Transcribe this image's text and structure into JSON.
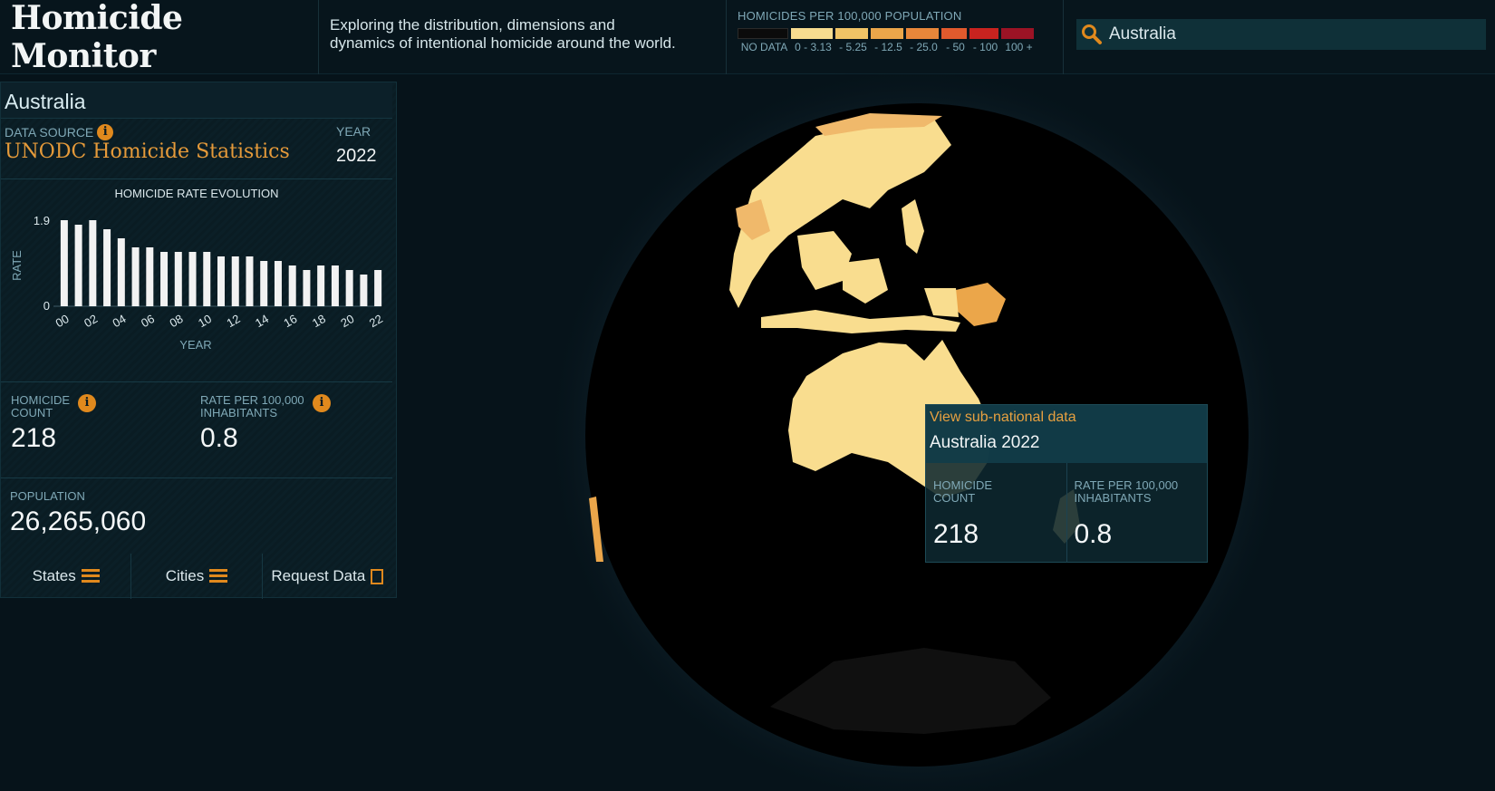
{
  "header": {
    "title": "Homicide Monitor",
    "tagline_line1": "Exploring the distribution, dimensions and",
    "tagline_line2": "dynamics of intentional homicide around the world.",
    "legend_title": "HOMICIDES PER 100,000 POPULATION",
    "legend": [
      {
        "label": "NO DATA",
        "color": "#0b0b0b"
      },
      {
        "label": "0 - 3.13",
        "color": "#f7dc8f"
      },
      {
        "label": "- 5.25",
        "color": "#f0c466"
      },
      {
        "label": "- 12.5",
        "color": "#eba64a"
      },
      {
        "label": "- 25.0",
        "color": "#e8873a"
      },
      {
        "label": "- 50",
        "color": "#e15a2d"
      },
      {
        "label": "- 100",
        "color": "#c8231f"
      },
      {
        "label": "100 +",
        "color": "#9b1325"
      }
    ],
    "search_value": "Australia"
  },
  "panel": {
    "country": "Australia",
    "data_source_label": "DATA SOURCE",
    "data_source": "UNODC Homicide Statistics",
    "year_label": "YEAR",
    "year": "2022",
    "chart_title": "HOMICIDE RATE EVOLUTION",
    "homicide_count_label_1": "HOMICIDE",
    "homicide_count_label_2": "COUNT",
    "homicide_count": "218",
    "rate_label_1": "RATE PER 100,000",
    "rate_label_2": "INHABITANTS",
    "rate": "0.8",
    "population_label": "POPULATION",
    "population": "26,265,060",
    "btn_states": "States",
    "btn_cities": "Cities",
    "btn_request": "Request Data"
  },
  "tooltip": {
    "link": "View sub-national data",
    "title": "Australia 2022",
    "count_label_1": "HOMICIDE",
    "count_label_2": "COUNT",
    "count": "218",
    "rate_label_1": "RATE PER 100,000",
    "rate_label_2": "INHABITANTS",
    "rate": "0.8"
  },
  "chart_data": {
    "type": "bar",
    "title": "HOMICIDE RATE EVOLUTION",
    "xlabel": "YEAR",
    "ylabel": "RATE",
    "ylim": [
      0,
      1.9
    ],
    "yticks": [
      "1.9",
      "0"
    ],
    "tick_labels": [
      "00",
      "02",
      "04",
      "06",
      "08",
      "10",
      "12",
      "14",
      "16",
      "18",
      "20",
      "22"
    ],
    "categories": [
      "2000",
      "2001",
      "2002",
      "2003",
      "2004",
      "2005",
      "2006",
      "2007",
      "2008",
      "2009",
      "2010",
      "2011",
      "2012",
      "2013",
      "2014",
      "2015",
      "2016",
      "2017",
      "2018",
      "2019",
      "2020",
      "2021",
      "2022"
    ],
    "values": [
      1.9,
      1.8,
      1.9,
      1.7,
      1.5,
      1.3,
      1.3,
      1.2,
      1.2,
      1.2,
      1.2,
      1.1,
      1.1,
      1.1,
      1.0,
      1.0,
      0.9,
      0.8,
      0.9,
      0.9,
      0.8,
      0.7,
      0.8
    ],
    "grid": false,
    "legend": "none"
  },
  "colors": {
    "accent": "#e0891d",
    "background": "#06131a",
    "panel": "#0b1f27"
  }
}
